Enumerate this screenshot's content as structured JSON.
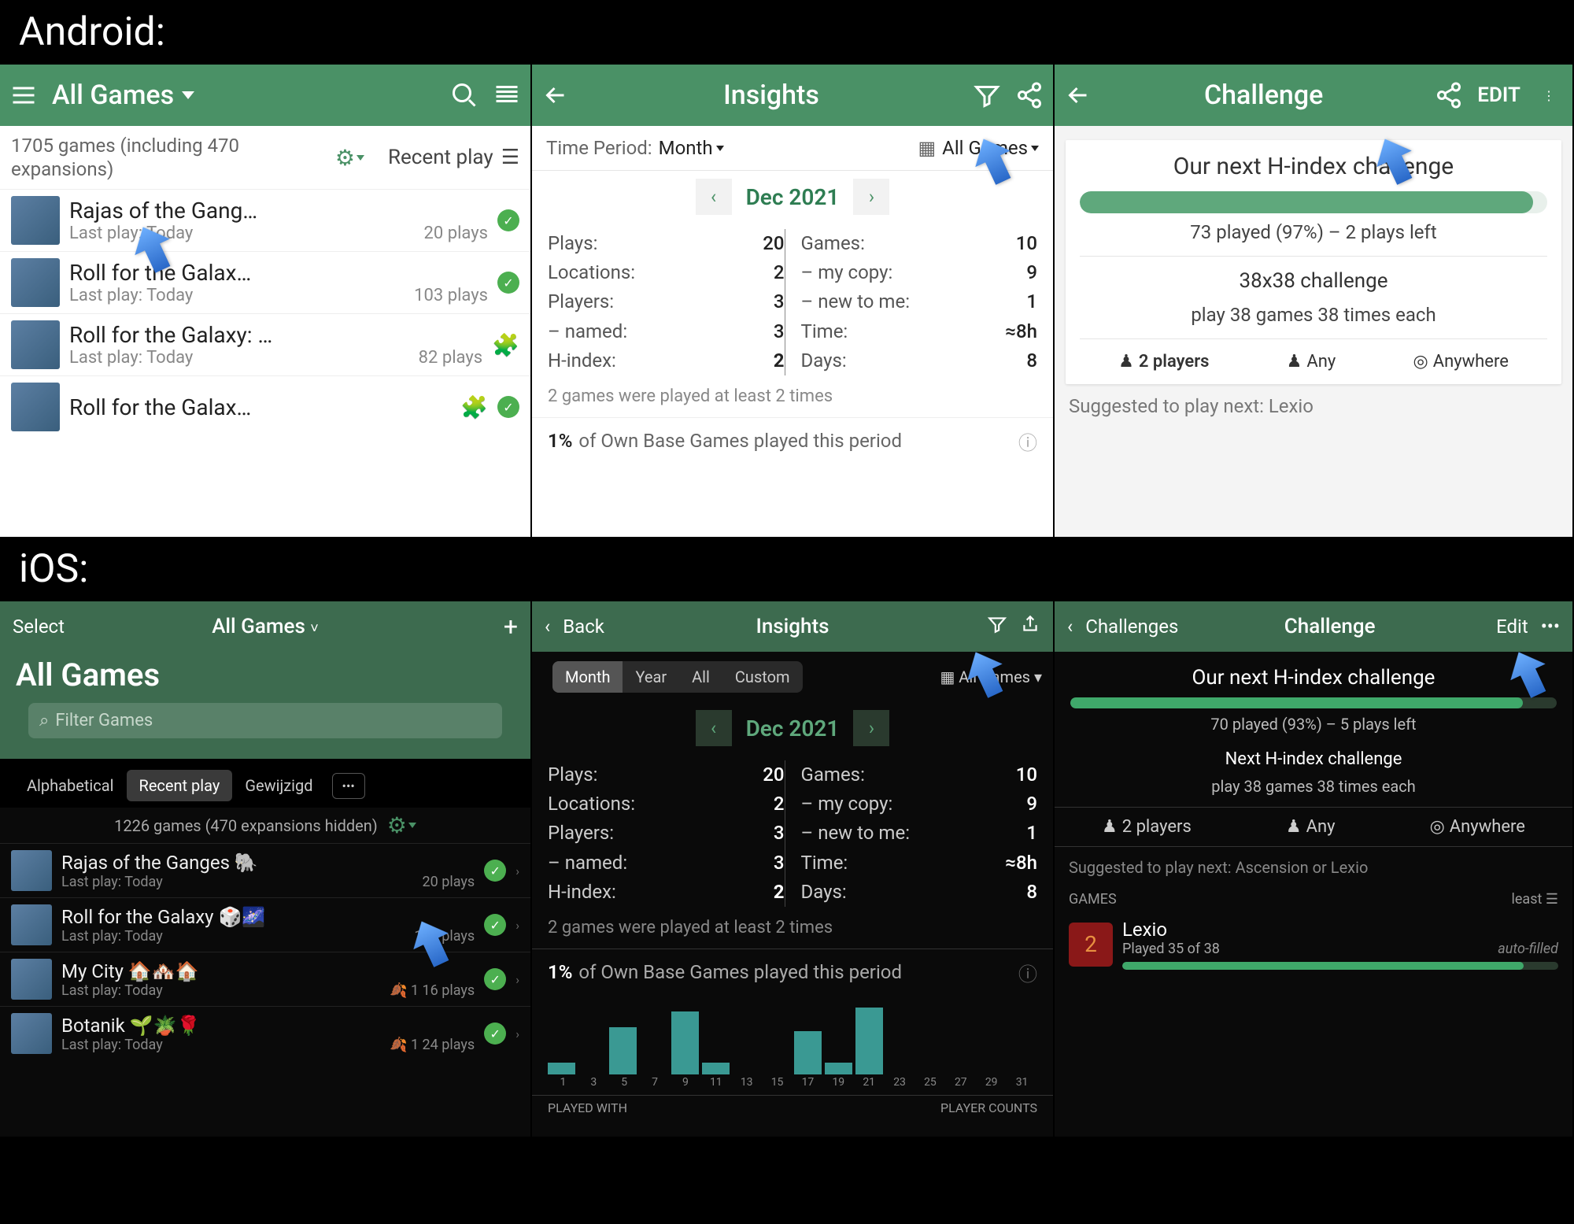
{
  "labels": {
    "android": "Android:",
    "ios": "iOS:"
  },
  "android": {
    "games": {
      "header_title": "All Games",
      "counts": "1705 games (including 470 expansions)",
      "sort": "Recent play",
      "items": [
        {
          "title": "Rajas of the Gang…",
          "sub": "Last play: Today",
          "plays": "20 plays",
          "badge": "check"
        },
        {
          "title": "Roll for the Galax…",
          "sub": "Last play: Today",
          "plays": "103 plays",
          "badge": "check"
        },
        {
          "title": "Roll for the Galaxy: …",
          "sub": "Last play: Today",
          "plays": "82 plays",
          "badge": "puzzle"
        },
        {
          "title": "Roll for the Galax…",
          "sub": "",
          "plays": "",
          "badge": "puzzle_check"
        }
      ]
    },
    "insights": {
      "header_title": "Insights",
      "period_label": "Time Period:",
      "period_value": "Month",
      "collection": "All Games",
      "month": "Dec 2021",
      "left": [
        {
          "k": "Plays:",
          "v": "20"
        },
        {
          "k": "Locations:",
          "v": "2"
        },
        {
          "k": "Players:",
          "v": "3"
        },
        {
          "k": "– named:",
          "v": "3"
        },
        {
          "k": "H-index:",
          "v": "2",
          "bold": true
        }
      ],
      "right": [
        {
          "k": "Games:",
          "v": "10"
        },
        {
          "k": "– my copy:",
          "v": "9"
        },
        {
          "k": "– new to me:",
          "v": "1"
        },
        {
          "k": "Time:",
          "v": "≈8h"
        },
        {
          "k": "Days:",
          "v": "8"
        }
      ],
      "note": "2 games were played at least 2 times",
      "pct": "1%",
      "pct_text": "of Own Base Games played this period"
    },
    "challenge": {
      "header_title": "Challenge",
      "edit": "EDIT",
      "c1_title": "Our next H-index challenge",
      "c1_sub": "73 played (97%) – 2 plays left",
      "c1_pct": 97,
      "c2_title": "38x38 challenge",
      "c2_sub": "play 38 games 38 times each",
      "meta_players": "2 players",
      "meta_any": "Any",
      "meta_where": "Anywhere",
      "suggested": "Suggested to play next: Lexio"
    }
  },
  "ios": {
    "games": {
      "select": "Select",
      "dd": "All Games",
      "big_title": "All Games",
      "search_placeholder": "Filter Games",
      "tabs": [
        "Alphabetical",
        "Recent play",
        "Gewijzigd"
      ],
      "tab_active": 1,
      "count": "1226 games (470 expansions hidden)",
      "items": [
        {
          "title": "Rajas of the Ganges 🐘",
          "sub": "Last play: Today",
          "plays": "20 plays"
        },
        {
          "title": "Roll for the Galaxy 🎲🌌",
          "sub": "Last play: Today",
          "plays": "103 plays"
        },
        {
          "title": "My City 🏠🏘️🏠",
          "sub": "Last play: Today",
          "plays": "16 plays",
          "leaf": "1"
        },
        {
          "title": "Botanik 🌱🪴🌹",
          "sub": "Last play: Today",
          "plays": "24 plays",
          "leaf": "1"
        }
      ]
    },
    "insights": {
      "back": "Back",
      "header_title": "Insights",
      "segments": [
        "Month",
        "Year",
        "All",
        "Custom"
      ],
      "seg_active": 0,
      "collection": "All Games",
      "month": "Dec 2021",
      "left": [
        {
          "k": "Plays:",
          "v": "20"
        },
        {
          "k": "Locations:",
          "v": "2"
        },
        {
          "k": "Players:",
          "v": "3"
        },
        {
          "k": "– named:",
          "v": "3"
        },
        {
          "k": "H-index:",
          "v": "2",
          "bold": true
        }
      ],
      "right": [
        {
          "k": "Games:",
          "v": "10"
        },
        {
          "k": "– my copy:",
          "v": "9"
        },
        {
          "k": "– new to me:",
          "v": "1"
        },
        {
          "k": "Time:",
          "v": "≈8h"
        },
        {
          "k": "Days:",
          "v": "8"
        }
      ],
      "note": "2 games were played at least 2 times",
      "pct": "1%",
      "pct_text": "of Own Base Games played this period",
      "axis": [
        "1",
        "3",
        "5",
        "7",
        "9",
        "11",
        "13",
        "15",
        "17",
        "19",
        "21",
        "23",
        "25",
        "27",
        "29",
        "31"
      ],
      "played_with": "PLAYED WITH",
      "player_counts": "PLAYER COUNTS"
    },
    "challenge": {
      "back": "Challenges",
      "header_title": "Challenge",
      "edit": "Edit",
      "c1_title": "Our next H-index challenge",
      "c1_sub": "70 played (93%) – 5 plays left",
      "c1_pct": 93,
      "c2_title": "Next H-index challenge",
      "c2_sub": "play 38 games 38 times each",
      "meta_players": "2 players",
      "meta_any": "Any",
      "meta_where": "Anywhere",
      "suggested": "Suggested to play next: Ascension or Lexio",
      "games_hdr": "GAMES",
      "least": "least",
      "game_name": "Lexio",
      "game_played": "Played 35 of 38",
      "auto": "auto-filled"
    }
  }
}
